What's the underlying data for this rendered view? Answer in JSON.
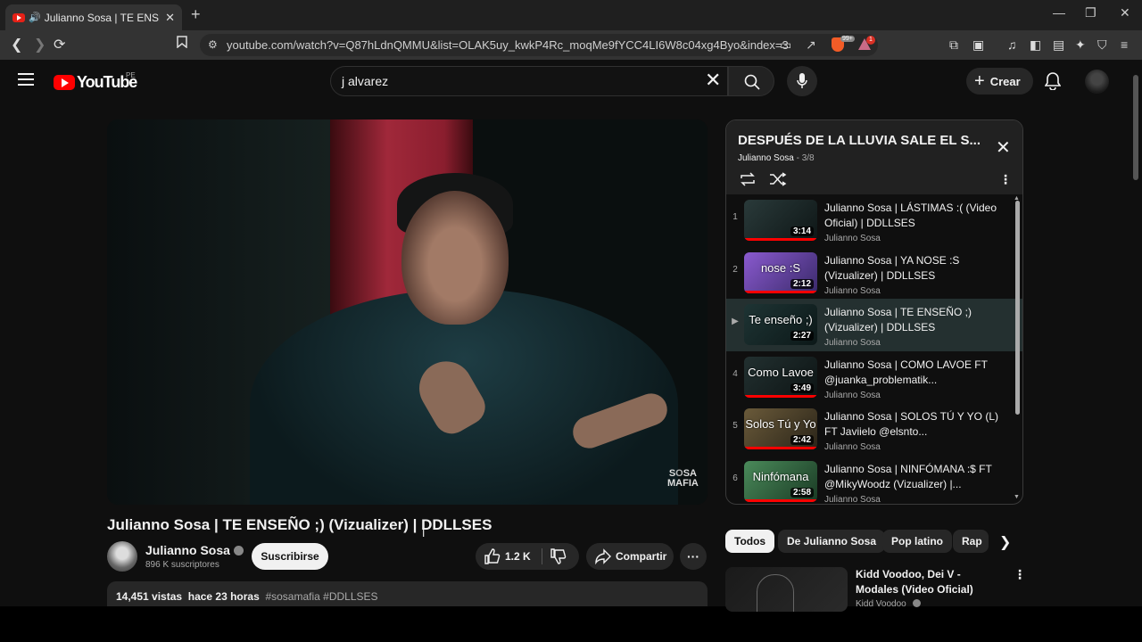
{
  "browser": {
    "tab_title": "Julianno Sosa | TE ENSEÑO ;)",
    "url": "youtube.com/watch?v=Q87hLdnQMMU&list=OLAK5uy_kwkP4Rc_moqMe9fYCC4LI6W8c04xg4Byo&index=3",
    "brave_badge": "99+",
    "alert_badge": "1"
  },
  "header": {
    "logo_text": "YouTube",
    "country_code": "PE",
    "search_value": "j alvarez",
    "create_label": "Crear"
  },
  "video": {
    "watermark": "SOSA\nMAFIA",
    "title": "Julianno Sosa | TE ENSEÑO ;) (Vizualizer) | DDLLSES",
    "channel": "Julianno Sosa",
    "subscribers": "896 K suscriptores",
    "subscribe_label": "Suscribirse",
    "likes": "1.2 K",
    "share_label": "Compartir",
    "views": "14,451 vistas",
    "age": "hace 23 horas",
    "tags": "#sosamafia #DDLLSES"
  },
  "playlist": {
    "title": "DESPUÉS DE LA LLUVIA SALE EL S...",
    "owner": "Julianno Sosa",
    "position": "3/8",
    "items": [
      {
        "index": "1",
        "title": "Julianno Sosa | LÁSTIMAS :( (Video Oficial) | DDLLSES",
        "channel": "Julianno Sosa",
        "duration": "3:14",
        "caption": ""
      },
      {
        "index": "2",
        "title": "Julianno Sosa | YA NOSE :S (Vizualizer) | DDLLSES",
        "channel": "Julianno Sosa",
        "duration": "2:12",
        "caption": "nose :S"
      },
      {
        "index": "▶",
        "title": "Julianno Sosa | TE ENSEÑO ;) (Vizualizer) | DDLLSES",
        "channel": "Julianno Sosa",
        "duration": "2:27",
        "caption": "Te enseño ;)"
      },
      {
        "index": "4",
        "title": "Julianno Sosa | COMO LAVOE FT @juanka_problematik...",
        "channel": "Julianno Sosa",
        "duration": "3:49",
        "caption": "Como Lavoe"
      },
      {
        "index": "5",
        "title": "Julianno Sosa | SOLOS TÚ Y YO (L) FT Javiielo @elsnto...",
        "channel": "Julianno Sosa",
        "duration": "2:42",
        "caption": "Solos Tú y Yo"
      },
      {
        "index": "6",
        "title": "Julianno Sosa | NINFÓMANA :$ FT @MikyWoodz (Vizualizer) |...",
        "channel": "Julianno Sosa",
        "duration": "2:58",
        "caption": "Ninfómana"
      }
    ]
  },
  "chips": [
    "Todos",
    "De Julianno Sosa",
    "Pop latino",
    "Rap"
  ],
  "recommendation": {
    "title": "Kidd Voodoo, Dei V - Modales (Video Oficial)",
    "channel": "Kidd Voodoo"
  },
  "colors": {
    "brand_red": "#ff0000",
    "active_row": "#243030"
  }
}
